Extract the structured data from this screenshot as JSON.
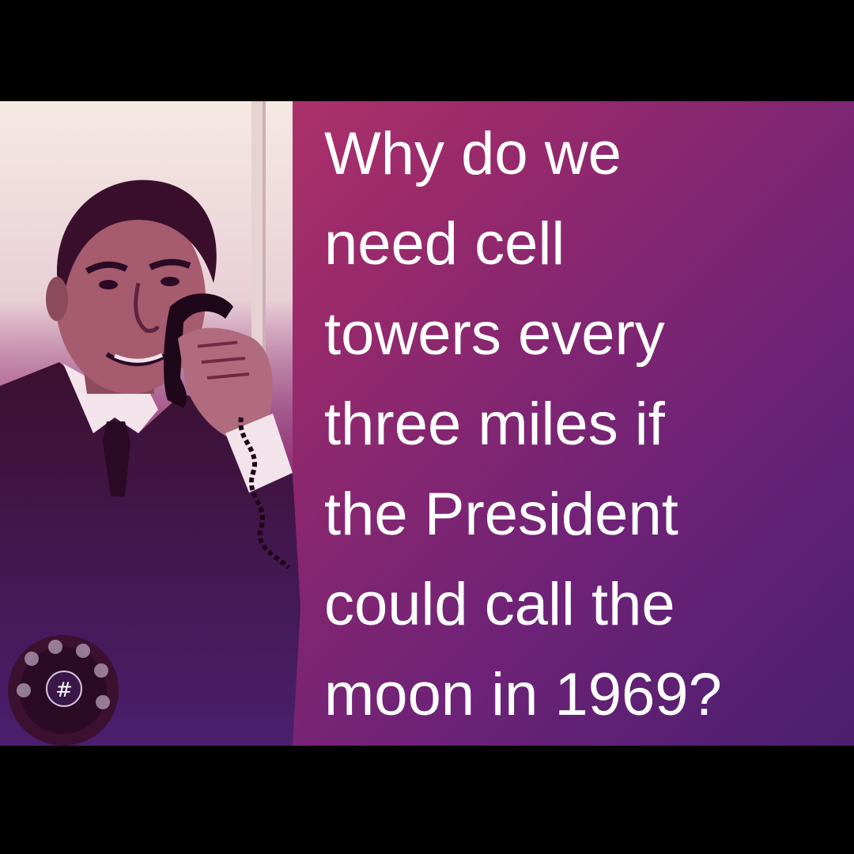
{
  "meme": {
    "text_lines": [
      "Why do we",
      "need cell",
      "towers every",
      "three miles if",
      "the President",
      "could call the",
      "moon in 1969?"
    ],
    "text_color": "#ffffff",
    "background_gradient": [
      "#c23a6a",
      "#9a2a6b",
      "#6e2277",
      "#4a1f6e"
    ],
    "photo": {
      "subject": "man in suit talking on a corded telephone",
      "icon": "person-on-phone-photo"
    },
    "badge": {
      "symbol": "#",
      "icon": "hashtag-icon"
    }
  }
}
